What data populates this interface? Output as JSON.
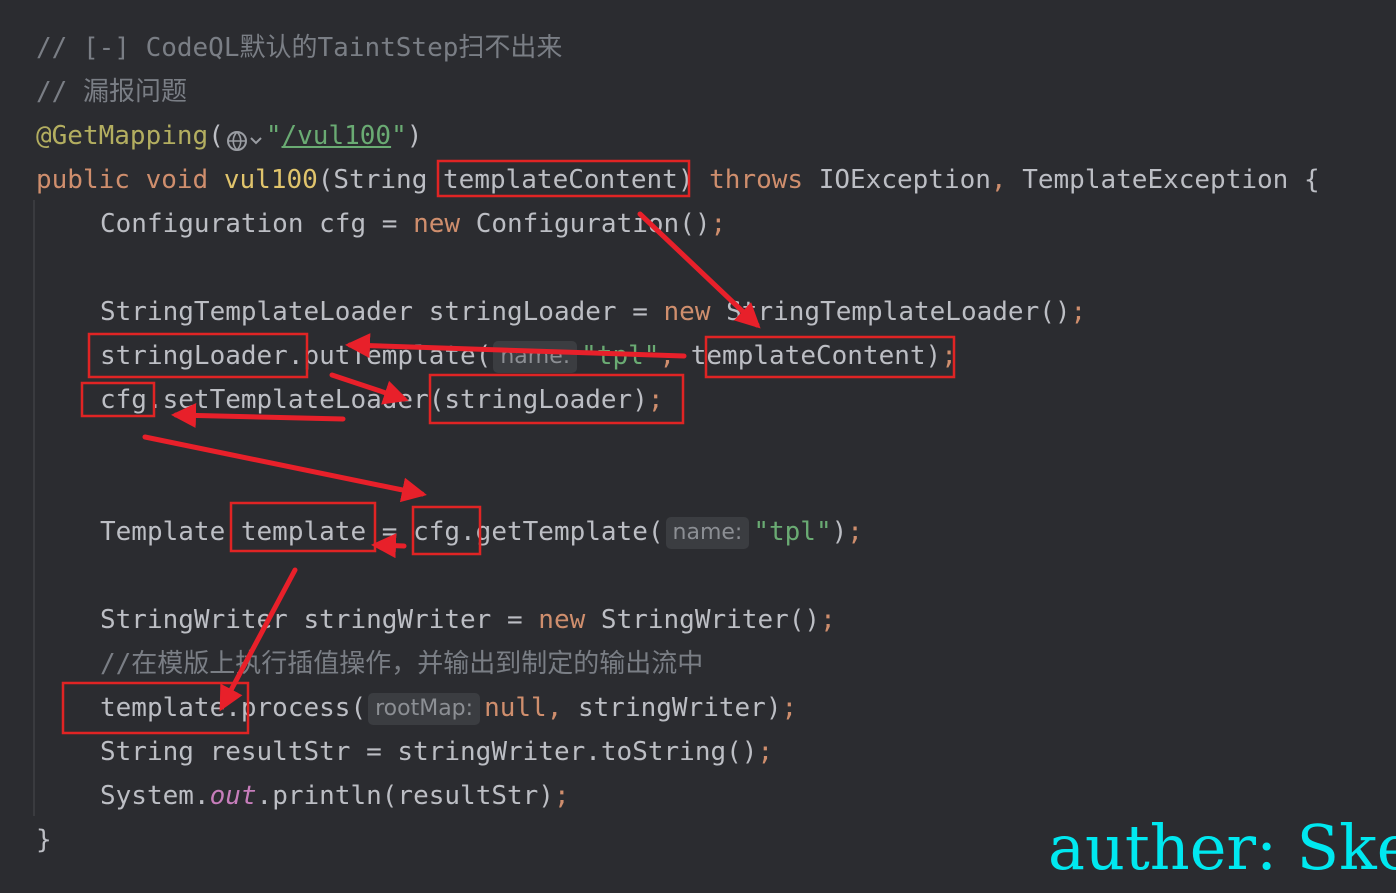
{
  "code": {
    "comment1": "// [-] CodeQL默认的TaintStep扫不出来",
    "comment2": "// 漏报问题",
    "annotation": "@GetMapping",
    "open_paren": "(",
    "mapping_path_q1": "\"",
    "mapping_path": "/vul100",
    "mapping_path_q2": "\"",
    "close_paren": ")",
    "kw_public": "public",
    "kw_void": "void",
    "method_name": "vul100",
    "param_type": "(String ",
    "param_name": "templateContent",
    "param_close": ") ",
    "kw_throws": "throws",
    "exceptions": " IOException",
    "comma": ",",
    "exceptions2": " TemplateException {",
    "l1_a": "Configuration cfg = ",
    "kw_new": "new",
    "l1_b": " Configuration()",
    "semicolon": ";",
    "l2_a": "StringTemplateLoader stringLoader = ",
    "l2_b": " StringTemplateLoader()",
    "l3_a": "stringLoader.putTemplate(",
    "hint_name": "name:",
    "str_tpl": "\"tpl\"",
    "l3_b": " templateContent)",
    "l4": "cfg.setTemplateLoader(stringLoader)",
    "l5_a": "Template template = cfg.getTemplate(",
    "l5_b": ")",
    "l6_a": "StringWriter stringWriter = ",
    "l6_b": " StringWriter()",
    "comment3": "//在模版上执行插值操作，并输出到制定的输出流中",
    "l7_a": "template.process(",
    "hint_rootmap": "rootMap:",
    "kw_null": "null",
    "l7_b": " stringWriter)",
    "l8": "String resultStr = stringWriter.toString()",
    "l9_a": "System.",
    "l9_out": "out",
    "l9_b": ".println(resultStr)",
    "close_brace": "}"
  },
  "watermark": "auther: Ske",
  "colors": {
    "background": "#2b2c30",
    "highlight_box": "#e02424",
    "arrow": "#e8202a",
    "watermark": "#00e8f0"
  }
}
